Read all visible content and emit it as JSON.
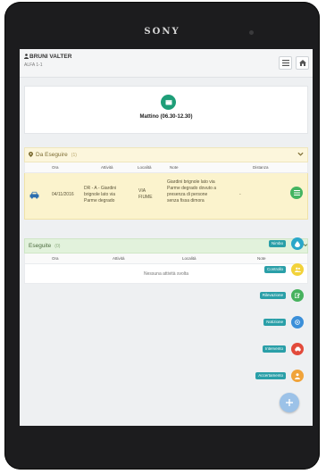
{
  "device": {
    "brand": "SONY"
  },
  "header": {
    "user_name": "BRUNI VALTER",
    "unit": "ALFA 1-1"
  },
  "shift": {
    "label": "Mattino (06.30-12.30)"
  },
  "todo": {
    "title": "Da Eseguire",
    "count": "(1)",
    "columns": [
      "Ora",
      "Attività",
      "Località",
      "Note",
      "Distanza"
    ],
    "row": {
      "date": "04/11/2016",
      "activity": [
        "DR - A - Giardini",
        "brignole lato via",
        "Parme degrado"
      ],
      "location": [
        "VIA",
        "FIUME"
      ],
      "notes": [
        "Giardini brignole lato via",
        "Parme degrado dovuto a",
        "presenza di persone",
        "senza fissa dimora"
      ],
      "distance": "-"
    }
  },
  "done": {
    "title": "Eseguite",
    "count": "(0)",
    "columns": [
      "Ora",
      "Attività",
      "Località",
      "Note"
    ],
    "empty_text": "Nessuna attività svolta"
  },
  "fab_menu": {
    "items": [
      {
        "label": "Nimbo",
        "color": "#2aa7c9"
      },
      {
        "label": "Controllo",
        "color": "#f2d23a"
      },
      {
        "label": "Rilevazione",
        "color": "#47b25e"
      },
      {
        "label": "Notizione",
        "color": "#3b8fd9"
      },
      {
        "label": "Intervento",
        "color": "#e24a3b"
      },
      {
        "label": "Accertamento",
        "color": "#f0a33a"
      }
    ],
    "main_icon": "plus-icon"
  },
  "colors": {
    "accent": "#1e9e78",
    "todo_bg": "#fbf3cd",
    "done_bg": "#e2f2dc",
    "fab_label": "#2a9fa8"
  }
}
